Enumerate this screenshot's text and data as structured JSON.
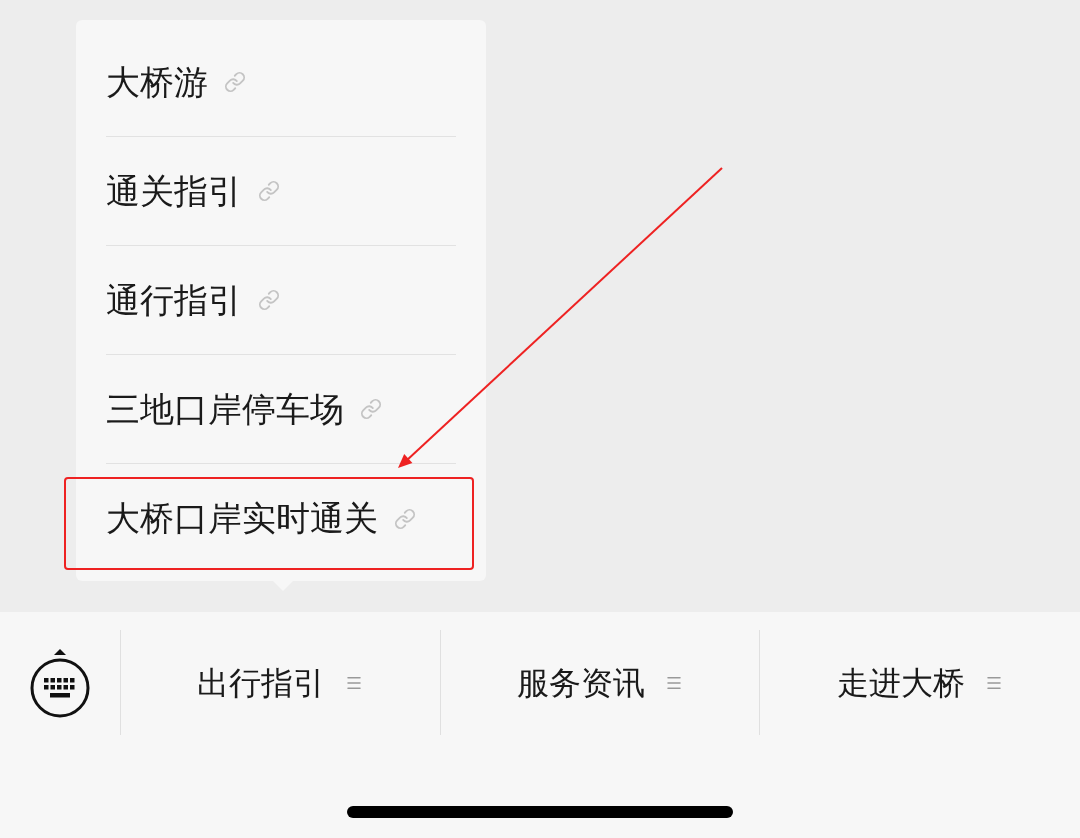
{
  "popup_menu": {
    "items": [
      {
        "label": "大桥游",
        "highlighted": false
      },
      {
        "label": "通关指引",
        "highlighted": false
      },
      {
        "label": "通行指引",
        "highlighted": false
      },
      {
        "label": "三地口岸停车场",
        "highlighted": false
      },
      {
        "label": "大桥口岸实时通关",
        "highlighted": true
      }
    ]
  },
  "bottom_menu": {
    "items": [
      {
        "label": "出行指引"
      },
      {
        "label": "服务资讯"
      },
      {
        "label": "走进大桥"
      }
    ]
  }
}
